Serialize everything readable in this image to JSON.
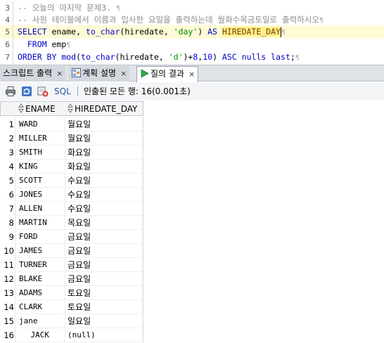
{
  "editor": {
    "lines": [
      {
        "n": "3",
        "segs": [
          {
            "t": "-- ",
            "c": "cmt"
          },
          {
            "t": "오늘의 마지막 문제3.",
            "c": "cmt"
          },
          {
            "t": " ",
            "c": ""
          }
        ]
      },
      {
        "n": "4",
        "segs": [
          {
            "t": "-- 사원 테이블에서 이름과 입사한 요일을 출력하는데 월화수목금토일로 출력하시오",
            "c": "cmt"
          }
        ]
      },
      {
        "n": "5",
        "segs": [
          {
            "t": "SELECT",
            "c": "kw"
          },
          {
            "t": " ename, ",
            "c": ""
          },
          {
            "t": "to_char",
            "c": "kw"
          },
          {
            "t": "(hiredate, ",
            "c": ""
          },
          {
            "t": "'day'",
            "c": "str"
          },
          {
            "t": ") ",
            "c": ""
          },
          {
            "t": "AS",
            "c": "kw"
          },
          {
            "t": " ",
            "c": ""
          },
          {
            "t": "HIREDATE_DAY",
            "c": "ident"
          }
        ]
      },
      {
        "n": "6",
        "segs": [
          {
            "t": "  ",
            "c": ""
          },
          {
            "t": "FROM",
            "c": "kw"
          },
          {
            "t": " emp",
            "c": ""
          }
        ]
      },
      {
        "n": "7",
        "segs": [
          {
            "t": "ORDER BY",
            "c": "kw"
          },
          {
            "t": " ",
            "c": ""
          },
          {
            "t": "mod",
            "c": "kw"
          },
          {
            "t": "(",
            "c": ""
          },
          {
            "t": "to_char",
            "c": "kw"
          },
          {
            "t": "(hiredate, ",
            "c": ""
          },
          {
            "t": "'d'",
            "c": "str"
          },
          {
            "t": ")+",
            "c": ""
          },
          {
            "t": "8",
            "c": "num"
          },
          {
            "t": ",",
            "c": ""
          },
          {
            "t": "10",
            "c": "num"
          },
          {
            "t": ") ",
            "c": ""
          },
          {
            "t": "ASC",
            "c": "kw"
          },
          {
            "t": " ",
            "c": ""
          },
          {
            "t": "nulls last",
            "c": "kw"
          },
          {
            "t": ";",
            "c": ""
          }
        ]
      }
    ]
  },
  "tabs": [
    {
      "label": "스크립트 출력",
      "close": "×",
      "icon": ""
    },
    {
      "label": "계획 설명",
      "close": "×",
      "icon": "explain-plan-icon"
    },
    {
      "label": "질의 결과",
      "close": "×",
      "icon": "run-query-icon"
    }
  ],
  "toolbar": {
    "sql_label": "SQL",
    "status": "인출된 모든 행: 16(0.001초)"
  },
  "grid": {
    "columns": [
      "ENAME",
      "HIREDATE_DAY"
    ],
    "rows": [
      {
        "num": "1",
        "ename": "WARD",
        "day": "월요일"
      },
      {
        "num": "2",
        "ename": "MILLER",
        "day": "월요일"
      },
      {
        "num": "3",
        "ename": "SMITH",
        "day": "화요일"
      },
      {
        "num": "4",
        "ename": "KING",
        "day": "화요일"
      },
      {
        "num": "5",
        "ename": "SCOTT",
        "day": "수요일"
      },
      {
        "num": "6",
        "ename": "JONES",
        "day": "수요일"
      },
      {
        "num": "7",
        "ename": "ALLEN",
        "day": "수요일"
      },
      {
        "num": "8",
        "ename": "MARTIN",
        "day": "목요일"
      },
      {
        "num": "9",
        "ename": "FORD",
        "day": "금요일"
      },
      {
        "num": "10",
        "ename": "JAMES",
        "day": "금요일"
      },
      {
        "num": "11",
        "ename": "TURNER",
        "day": "금요일"
      },
      {
        "num": "12",
        "ename": "BLAKE",
        "day": "금요일"
      },
      {
        "num": "13",
        "ename": "ADAMS",
        "day": "토요일"
      },
      {
        "num": "14",
        "ename": "CLARK",
        "day": "토요일"
      },
      {
        "num": "15",
        "ename": "jane",
        "day": "일요일"
      },
      {
        "num": "16",
        "ename": "JACK",
        "day": "(null)"
      }
    ]
  },
  "colors": {
    "keyword": "#0000c8",
    "string": "#008f00",
    "comment": "#8c8c8c",
    "current_line": "#fffbd6",
    "identifier_highlight": "#fff18a"
  }
}
